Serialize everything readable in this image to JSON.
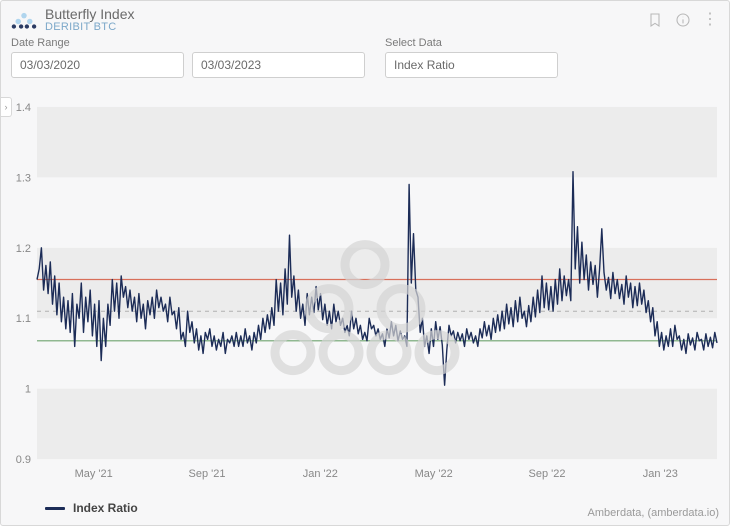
{
  "header": {
    "title": "Butterfly Index",
    "subtitle": "DERIBIT BTC"
  },
  "controls": {
    "date_range_label": "Date Range",
    "date_from": "03/03/2020",
    "date_to": "03/03/2023",
    "select_data_label": "Select Data",
    "select_data_value": "Index Ratio"
  },
  "legend": {
    "series1": "Index Ratio"
  },
  "credit": "Amberdata, (amberdata.io)",
  "colors": {
    "series": "#1c2c57",
    "upper_band": "#d86f5a",
    "lower_band": "#6fa36f",
    "mid_band": "#b0b0b0"
  },
  "chart_data": {
    "type": "line",
    "xlabel": "",
    "ylabel": "",
    "ylim": [
      0.9,
      1.4
    ],
    "y_ticks": [
      0.9,
      1.0,
      1.1,
      1.2,
      1.3,
      1.4
    ],
    "x_ticks": [
      "May '21",
      "Sep '21",
      "Jan '22",
      "May '22",
      "Sep '22",
      "Jan '23"
    ],
    "reference_lines": {
      "upper": 1.155,
      "mid": 1.11,
      "lower": 1.068
    },
    "series": [
      {
        "name": "Index Ratio",
        "x_start": "2021-03-03",
        "x_end": "2023-03-03",
        "values": [
          1.155,
          1.17,
          1.2,
          1.14,
          1.175,
          1.135,
          1.18,
          1.12,
          1.16,
          1.105,
          1.15,
          1.095,
          1.13,
          1.085,
          1.125,
          1.08,
          1.135,
          1.06,
          1.12,
          1.1,
          1.15,
          1.08,
          1.13,
          1.095,
          1.14,
          1.075,
          1.12,
          1.06,
          1.125,
          1.04,
          1.1,
          1.06,
          1.12,
          1.09,
          1.155,
          1.11,
          1.15,
          1.1,
          1.16,
          1.13,
          1.145,
          1.115,
          1.14,
          1.11,
          1.13,
          1.095,
          1.135,
          1.1,
          1.12,
          1.085,
          1.125,
          1.105,
          1.13,
          1.1,
          1.14,
          1.115,
          1.13,
          1.11,
          1.12,
          1.095,
          1.13,
          1.105,
          1.11,
          1.085,
          1.115,
          1.07,
          1.08,
          1.06,
          1.11,
          1.08,
          1.095,
          1.065,
          1.085,
          1.055,
          1.075,
          1.05,
          1.08,
          1.07,
          1.085,
          1.06,
          1.075,
          1.055,
          1.07,
          1.06,
          1.08,
          1.05,
          1.07,
          1.065,
          1.075,
          1.06,
          1.08,
          1.06,
          1.075,
          1.06,
          1.085,
          1.065,
          1.075,
          1.055,
          1.08,
          1.065,
          1.09,
          1.07,
          1.1,
          1.08,
          1.105,
          1.085,
          1.115,
          1.09,
          1.155,
          1.11,
          1.15,
          1.105,
          1.17,
          1.12,
          1.218,
          1.13,
          1.16,
          1.11,
          1.14,
          1.1,
          1.12,
          1.09,
          1.135,
          1.105,
          1.13,
          1.108,
          1.145,
          1.112,
          1.135,
          1.098,
          1.12,
          1.09,
          1.11,
          1.085,
          1.12,
          1.095,
          1.11,
          1.09,
          1.1,
          1.08,
          1.09,
          1.075,
          1.11,
          1.085,
          1.1,
          1.078,
          1.09,
          1.07,
          1.08,
          1.068,
          1.1,
          1.085,
          1.09,
          1.075,
          1.085,
          1.07,
          1.078,
          1.06,
          1.085,
          1.072,
          1.095,
          1.075,
          1.09,
          1.068,
          1.082,
          1.07,
          1.075,
          1.06,
          1.29,
          1.15,
          1.22,
          1.14,
          1.13,
          1.08,
          1.1,
          1.06,
          1.075,
          1.05,
          1.085,
          1.06,
          1.095,
          1.07,
          1.088,
          1.062,
          1.005,
          1.055,
          1.09,
          1.075,
          1.082,
          1.065,
          1.08,
          1.068,
          1.078,
          1.06,
          1.085,
          1.07,
          1.08,
          1.065,
          1.075,
          1.06,
          1.085,
          1.072,
          1.095,
          1.075,
          1.09,
          1.07,
          1.1,
          1.08,
          1.105,
          1.082,
          1.11,
          1.085,
          1.12,
          1.092,
          1.115,
          1.088,
          1.125,
          1.095,
          1.13,
          1.1,
          1.11,
          1.088,
          1.118,
          1.095,
          1.13,
          1.102,
          1.14,
          1.108,
          1.16,
          1.115,
          1.15,
          1.112,
          1.145,
          1.11,
          1.155,
          1.12,
          1.17,
          1.125,
          1.16,
          1.132,
          1.155,
          1.125,
          1.308,
          1.17,
          1.23,
          1.15,
          1.208,
          1.155,
          1.19,
          1.14,
          1.18,
          1.148,
          1.175,
          1.13,
          1.17,
          1.227,
          1.165,
          1.14,
          1.158,
          1.128,
          1.165,
          1.135,
          1.155,
          1.128,
          1.148,
          1.12,
          1.16,
          1.13,
          1.15,
          1.115,
          1.145,
          1.118,
          1.15,
          1.12,
          1.14,
          1.108,
          1.125,
          1.095,
          1.115,
          1.075,
          1.095,
          1.06,
          1.08,
          1.055,
          1.075,
          1.06,
          1.085,
          1.06,
          1.09,
          1.07,
          1.075,
          1.055,
          1.07,
          1.05,
          1.078,
          1.062,
          1.072,
          1.055,
          1.08,
          1.068,
          1.07,
          1.055,
          1.078,
          1.06,
          1.073,
          1.058,
          1.08,
          1.065
        ]
      }
    ]
  }
}
